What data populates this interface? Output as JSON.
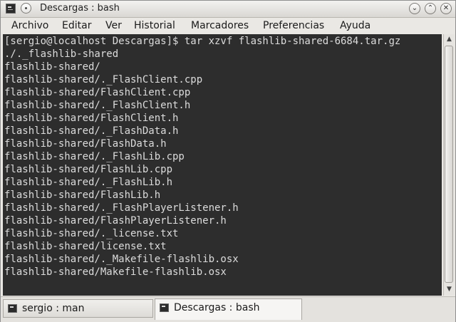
{
  "window": {
    "title": "Descargas : bash"
  },
  "titlebar_buttons": {
    "minimize": "⌄",
    "maximize": "⌃",
    "close": "✕"
  },
  "menu": [
    {
      "label": "Archivo"
    },
    {
      "label": "Editar"
    },
    {
      "label": "Ver"
    },
    {
      "label": "Historial"
    },
    {
      "label": "Marcadores"
    },
    {
      "label": "Preferencias"
    },
    {
      "label": "Ayuda"
    }
  ],
  "terminal": {
    "lines": [
      "[sergio@localhost Descargas]$ tar xzvf flashlib-shared-6684.tar.gz",
      "./._flashlib-shared",
      "flashlib-shared/",
      "flashlib-shared/._FlashClient.cpp",
      "flashlib-shared/FlashClient.cpp",
      "flashlib-shared/._FlashClient.h",
      "flashlib-shared/FlashClient.h",
      "flashlib-shared/._FlashData.h",
      "flashlib-shared/FlashData.h",
      "flashlib-shared/._FlashLib.cpp",
      "flashlib-shared/FlashLib.cpp",
      "flashlib-shared/._FlashLib.h",
      "flashlib-shared/FlashLib.h",
      "flashlib-shared/._FlashPlayerListener.h",
      "flashlib-shared/FlashPlayerListener.h",
      "flashlib-shared/._license.txt",
      "flashlib-shared/license.txt",
      "flashlib-shared/._Makefile-flashlib.osx",
      "flashlib-shared/Makefile-flashlib.osx"
    ]
  },
  "scrollbar": {
    "up": "▲",
    "down": "▼"
  },
  "tabs": [
    {
      "label": "sergio : man",
      "active": false
    },
    {
      "label": "Descargas : bash",
      "active": true
    }
  ],
  "colors": {
    "terminal_bg": "#2d2d2d",
    "terminal_fg": "#dcdcdc"
  }
}
